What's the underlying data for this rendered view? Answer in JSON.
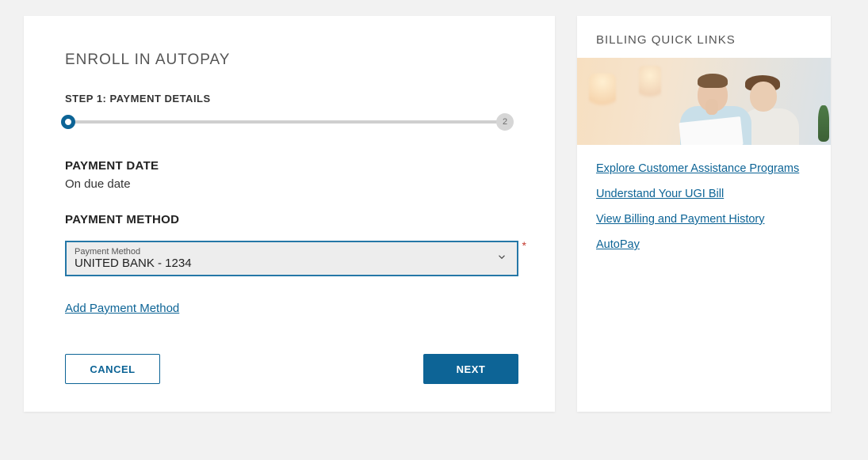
{
  "main": {
    "title": "ENROLL IN AUTOPAY",
    "step_label": "STEP 1: PAYMENT DETAILS",
    "step2_num": "2",
    "payment_date_heading": "PAYMENT DATE",
    "payment_date_value": "On due date",
    "payment_method_heading": "PAYMENT METHOD",
    "select_float_label": "Payment Method",
    "select_value": "UNITED BANK - 1234",
    "add_pm_label": "Add Payment Method",
    "cancel_label": "CANCEL",
    "next_label": "NEXT"
  },
  "sidebar": {
    "title": "BILLING QUICK LINKS",
    "links": [
      "Explore Customer Assistance Programs",
      "Understand Your UGI Bill",
      "View Billing and Payment History",
      "AutoPay"
    ]
  }
}
